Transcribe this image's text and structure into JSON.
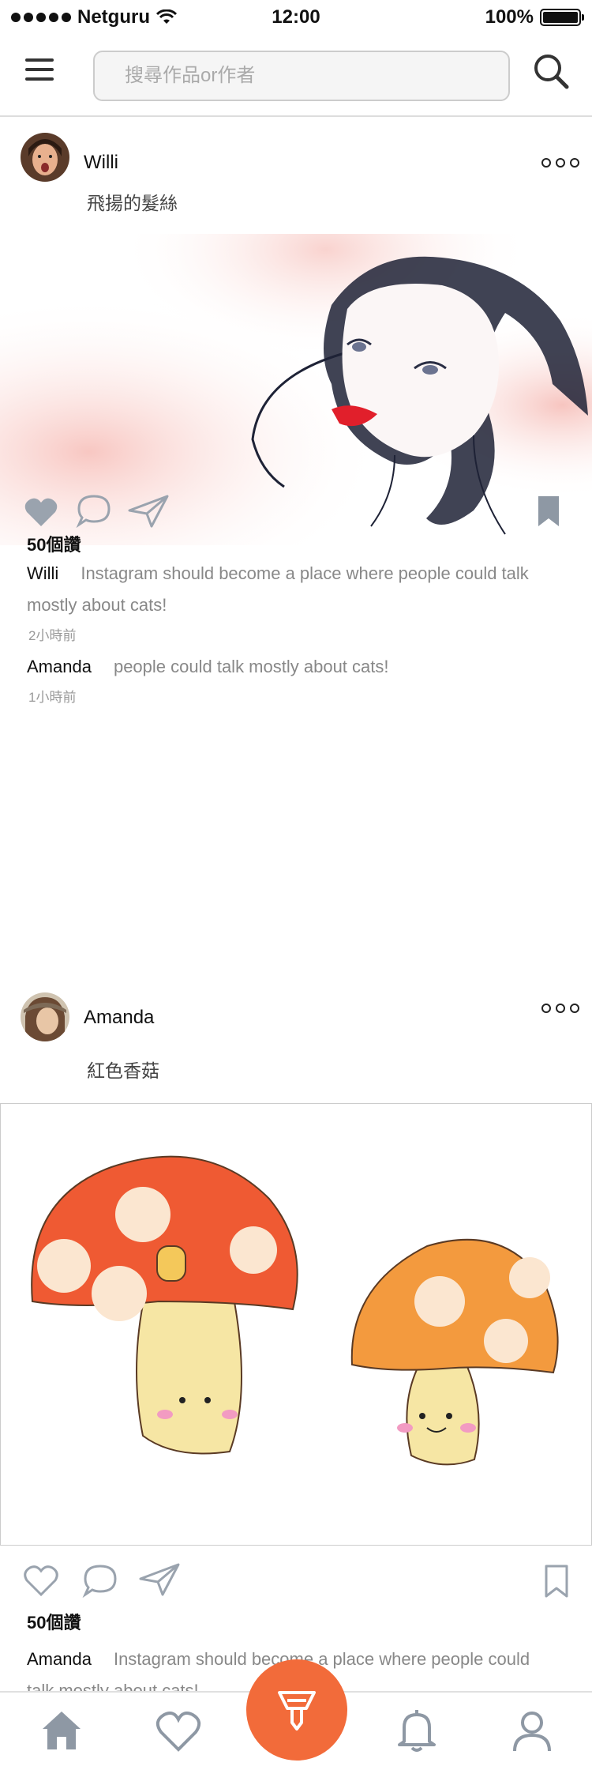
{
  "status": {
    "carrier": "Netguru",
    "time": "12:00",
    "battery": "100%"
  },
  "search": {
    "placeholder": "搜尋作品or作者"
  },
  "posts": [
    {
      "username": "Willi",
      "caption": "飛揚的髮絲",
      "likes": "50個讚",
      "comments": [
        {
          "user": "Willi",
          "text": "Instagram should become a place where people could talk mostly about cats!",
          "time": "2小時前"
        },
        {
          "user": "Amanda",
          "text": "people could talk mostly about cats!",
          "time": "1小時前"
        }
      ]
    },
    {
      "username": "Amanda",
      "caption": "紅色香菇",
      "likes": "50個讚",
      "comments": [
        {
          "user": "Amanda",
          "text": "Instagram should become a place where people could talk mostly about cats!"
        }
      ]
    }
  ],
  "tabs": [
    "home-icon",
    "heart-icon",
    "brush-icon",
    "bell-icon",
    "profile-icon"
  ],
  "colors": {
    "accent": "#f26b3a",
    "icon_gray": "#9aa3ae",
    "bookmark": "#8e98a4"
  }
}
